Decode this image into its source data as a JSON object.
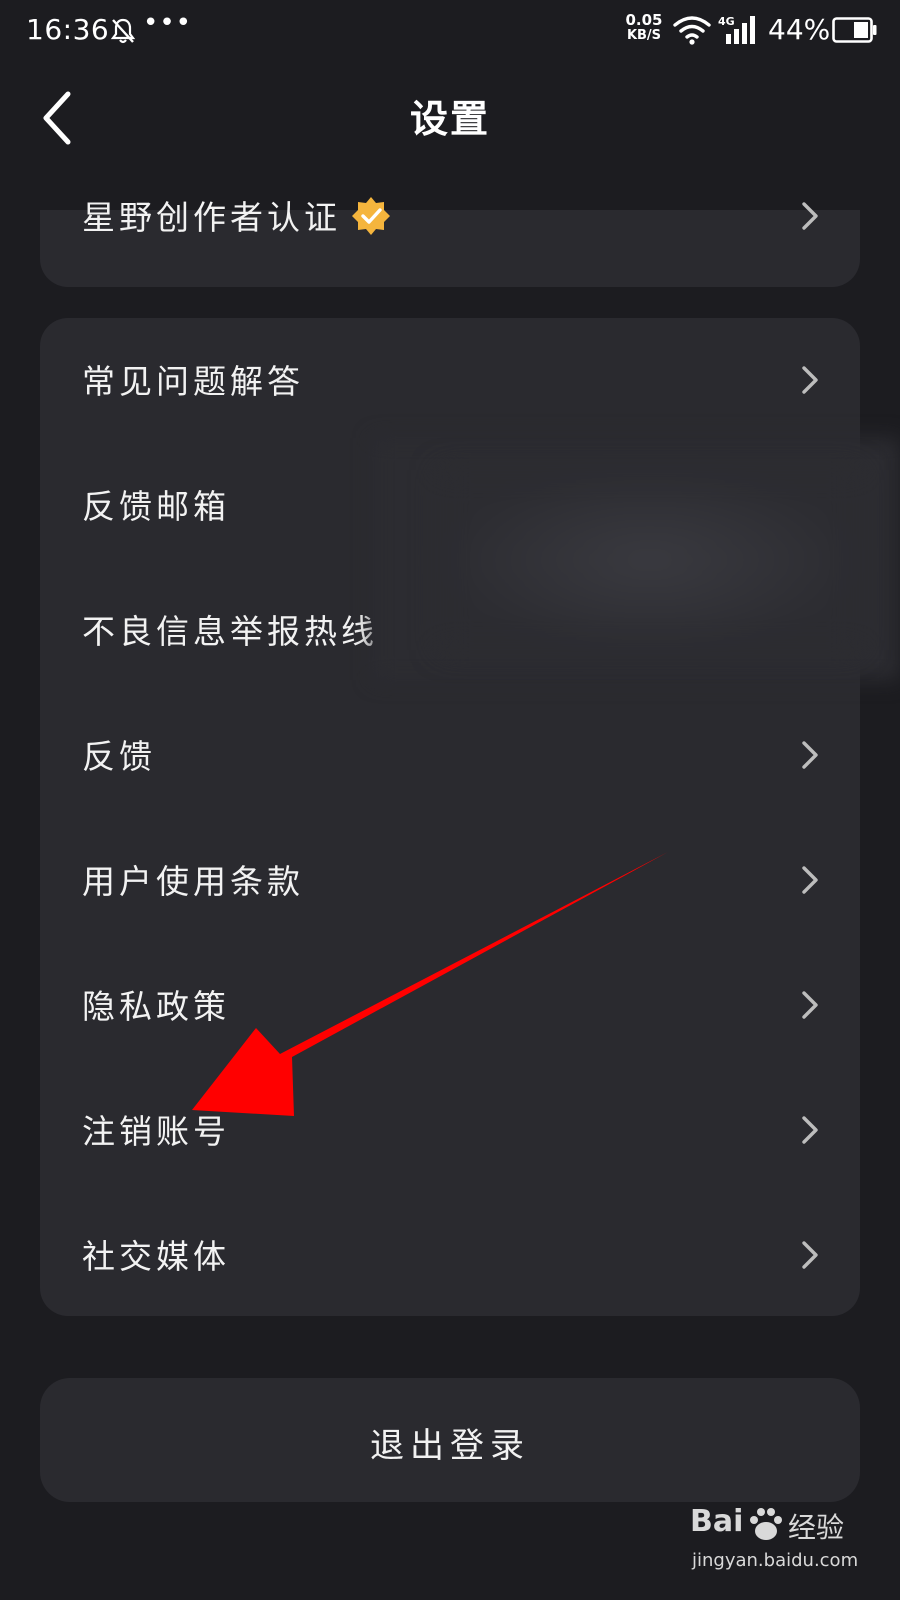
{
  "status_bar": {
    "time": "16:36",
    "more_indicator": "•••",
    "net_speed_value": "0.05",
    "net_speed_unit": "KB/S",
    "network_type": "4G",
    "battery_percent": "44%",
    "icons": [
      "mute-bell-icon",
      "wifi-icon",
      "signal-icon",
      "battery-icon"
    ]
  },
  "header": {
    "title": "设置",
    "back_icon": "chevron-left-icon"
  },
  "top_card": {
    "item": {
      "label": "星野创作者认证",
      "badge_icon": "verified-badge-icon",
      "badge_color": "#f5b53d"
    }
  },
  "settings_list": {
    "items": [
      {
        "label": "常见问题解答",
        "has_chevron": true
      },
      {
        "label": "反馈邮箱",
        "has_chevron": false
      },
      {
        "label": "不良信息举报热线",
        "has_chevron": false
      },
      {
        "label": "反馈",
        "has_chevron": true
      },
      {
        "label": "用户使用条款",
        "has_chevron": true
      },
      {
        "label": "隐私政策",
        "has_chevron": true
      },
      {
        "label": "注销账号",
        "has_chevron": true
      },
      {
        "label": "社交媒体",
        "has_chevron": true
      }
    ]
  },
  "logout": {
    "label": "退出登录"
  },
  "annotation": {
    "color": "#ff0000",
    "target": "注销账号"
  },
  "watermark": {
    "brand": "Bai",
    "brand_cn": "经验",
    "url": "jingyan.baidu.com"
  },
  "colors": {
    "background": "#1c1c20",
    "card": "#2a2a2f",
    "text": "#f2f2f2",
    "chevron": "#bdbdbd"
  }
}
